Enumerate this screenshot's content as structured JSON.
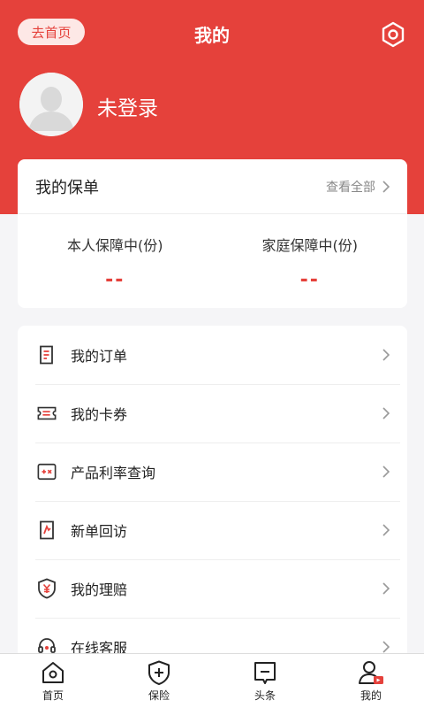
{
  "header": {
    "title": "我的",
    "home_label": "去首页",
    "user_status": "未登录",
    "accent_color": "#e5413b"
  },
  "policy": {
    "title": "我的保单",
    "view_all": "查看全部",
    "stats": [
      {
        "label": "本人保障中(份)",
        "value": "--"
      },
      {
        "label": "家庭保障中(份)",
        "value": "--"
      }
    ]
  },
  "menu": {
    "items": [
      {
        "label": "我的订单",
        "icon": "order-icon"
      },
      {
        "label": "我的卡券",
        "icon": "coupon-icon"
      },
      {
        "label": "产品利率查询",
        "icon": "calculator-icon"
      },
      {
        "label": "新单回访",
        "icon": "revisit-icon"
      },
      {
        "label": "我的理赔",
        "icon": "claim-icon"
      },
      {
        "label": "在线客服",
        "icon": "customer-service-icon"
      }
    ]
  },
  "tabbar": {
    "items": [
      {
        "label": "首页",
        "icon": "home-icon"
      },
      {
        "label": "保险",
        "icon": "insurance-shield-icon"
      },
      {
        "label": "头条",
        "icon": "headline-icon"
      },
      {
        "label": "我的",
        "icon": "profile-icon",
        "active": true
      }
    ]
  }
}
